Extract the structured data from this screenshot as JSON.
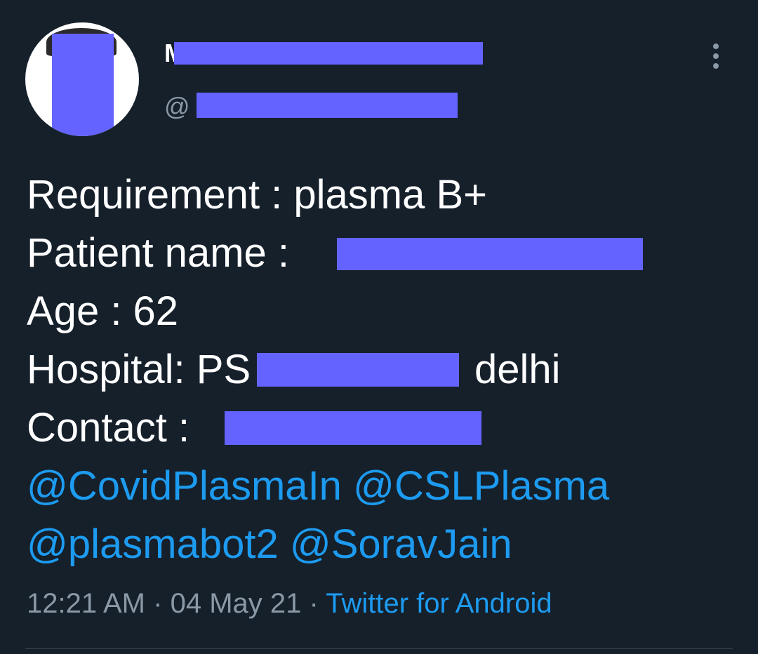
{
  "user": {
    "display_name": "M",
    "handle_prefix": "@"
  },
  "tweet": {
    "lines": [
      "Requirement : plasma B+",
      "Patient name : ",
      "Age : 62",
      "Hospital: PS",
      "Contact : "
    ],
    "hospital_suffix": "delhi",
    "mentions": [
      "@CovidPlasmaIn",
      "@CSLPlasma",
      "@plasmabot2",
      "@SoravJain"
    ]
  },
  "meta": {
    "time": "12:21 AM",
    "separator": "·",
    "date": "04 May 21",
    "source": "Twitter for Android"
  },
  "colors": {
    "background": "#15202b",
    "text": "#ffffff",
    "secondary": "#8b98a5",
    "link": "#1d9bf0",
    "redaction": "#6563ff"
  },
  "icons": {
    "more": "vertical-ellipsis-icon"
  }
}
